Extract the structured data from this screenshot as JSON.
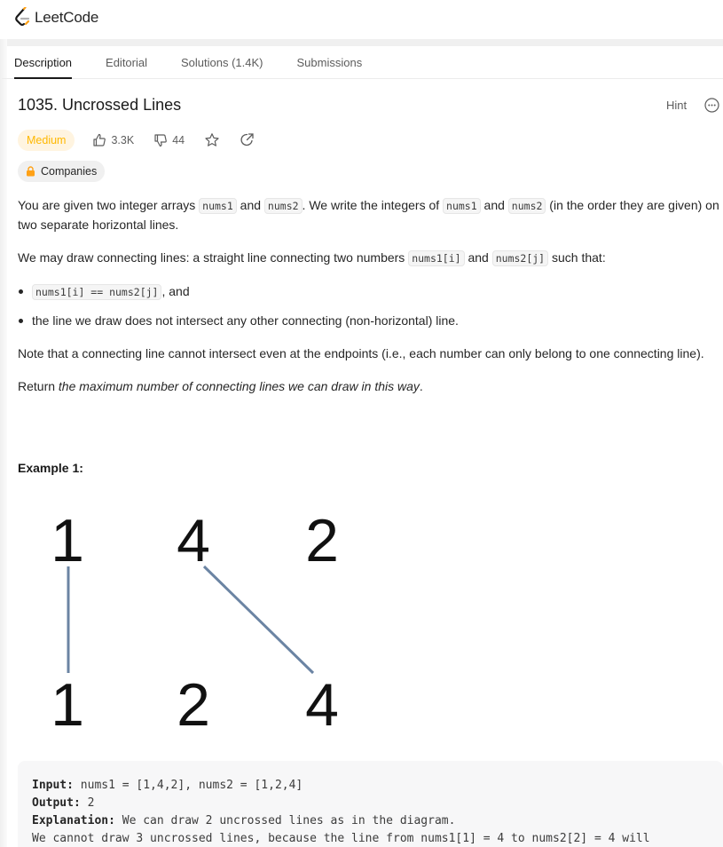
{
  "app": {
    "logo_text": "LeetCode"
  },
  "tabs": [
    {
      "label": "Description",
      "active": true
    },
    {
      "label": "Editorial",
      "active": false
    },
    {
      "label": "Solutions (1.4K)",
      "active": false
    },
    {
      "label": "Submissions",
      "active": false
    }
  ],
  "problem": {
    "title": "1035. Uncrossed Lines",
    "hint_label": "Hint",
    "difficulty": "Medium",
    "likes": "3.3K",
    "dislikes": "44",
    "companies_label": "Companies"
  },
  "description": {
    "p1": {
      "t1": "You are given two integer arrays ",
      "c1": "nums1",
      "t2": " and ",
      "c2": "nums2",
      "t3": ". We write the integers of ",
      "c3": "nums1",
      "t4": " and ",
      "c4": "nums2",
      "t5": " (in the order they are given) on two separate horizontal lines."
    },
    "p2": {
      "t1": "We may draw connecting lines: a straight line connecting two numbers ",
      "c1": "nums1[i]",
      "t2": " and ",
      "c2": "nums2[j]",
      "t3": " such that:"
    },
    "bullet1": {
      "c1": "nums1[i] == nums2[j]",
      "t1": ", and"
    },
    "bullet2": "the line we draw does not intersect any other connecting (non-horizontal) line.",
    "p3": "Note that a connecting line cannot intersect even at the endpoints (i.e., each number can only belong to one connecting line).",
    "p4": {
      "t1": "Return ",
      "em": "the maximum number of connecting lines we can draw in this way",
      "t2": "."
    }
  },
  "example1": {
    "heading": "Example 1:",
    "diagram": {
      "top": [
        "1",
        "4",
        "2"
      ],
      "bottom": [
        "1",
        "2",
        "4"
      ]
    },
    "input_label": "Input:",
    "input_value": " nums1 = [1,4,2], nums2 = [1,2,4]",
    "output_label": "Output:",
    "output_value": " 2",
    "explanation_label": "Explanation:",
    "explanation_value": " We can draw 2 uncrossed lines as in the diagram.",
    "explanation_line2": "We cannot draw 3 uncrossed lines, because the line from nums1[1] = 4 to nums2[2] = 4 will"
  },
  "colors": {
    "medium": "#ffb800",
    "medium_bg": "#fff4e0",
    "connector": "#6b84a3"
  }
}
